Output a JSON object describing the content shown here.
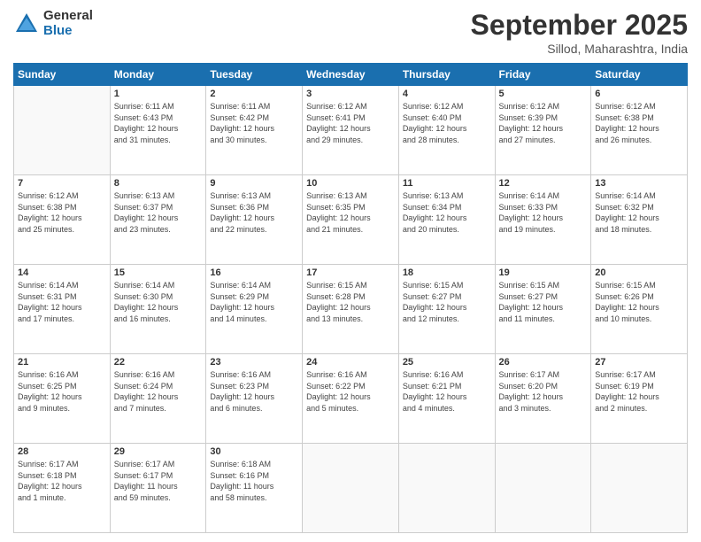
{
  "logo": {
    "general": "General",
    "blue": "Blue"
  },
  "header": {
    "month": "September 2025",
    "location": "Sillod, Maharashtra, India"
  },
  "weekdays": [
    "Sunday",
    "Monday",
    "Tuesday",
    "Wednesday",
    "Thursday",
    "Friday",
    "Saturday"
  ],
  "weeks": [
    [
      {
        "day": "",
        "info": ""
      },
      {
        "day": "1",
        "info": "Sunrise: 6:11 AM\nSunset: 6:43 PM\nDaylight: 12 hours\nand 31 minutes."
      },
      {
        "day": "2",
        "info": "Sunrise: 6:11 AM\nSunset: 6:42 PM\nDaylight: 12 hours\nand 30 minutes."
      },
      {
        "day": "3",
        "info": "Sunrise: 6:12 AM\nSunset: 6:41 PM\nDaylight: 12 hours\nand 29 minutes."
      },
      {
        "day": "4",
        "info": "Sunrise: 6:12 AM\nSunset: 6:40 PM\nDaylight: 12 hours\nand 28 minutes."
      },
      {
        "day": "5",
        "info": "Sunrise: 6:12 AM\nSunset: 6:39 PM\nDaylight: 12 hours\nand 27 minutes."
      },
      {
        "day": "6",
        "info": "Sunrise: 6:12 AM\nSunset: 6:38 PM\nDaylight: 12 hours\nand 26 minutes."
      }
    ],
    [
      {
        "day": "7",
        "info": "Sunrise: 6:12 AM\nSunset: 6:38 PM\nDaylight: 12 hours\nand 25 minutes."
      },
      {
        "day": "8",
        "info": "Sunrise: 6:13 AM\nSunset: 6:37 PM\nDaylight: 12 hours\nand 23 minutes."
      },
      {
        "day": "9",
        "info": "Sunrise: 6:13 AM\nSunset: 6:36 PM\nDaylight: 12 hours\nand 22 minutes."
      },
      {
        "day": "10",
        "info": "Sunrise: 6:13 AM\nSunset: 6:35 PM\nDaylight: 12 hours\nand 21 minutes."
      },
      {
        "day": "11",
        "info": "Sunrise: 6:13 AM\nSunset: 6:34 PM\nDaylight: 12 hours\nand 20 minutes."
      },
      {
        "day": "12",
        "info": "Sunrise: 6:14 AM\nSunset: 6:33 PM\nDaylight: 12 hours\nand 19 minutes."
      },
      {
        "day": "13",
        "info": "Sunrise: 6:14 AM\nSunset: 6:32 PM\nDaylight: 12 hours\nand 18 minutes."
      }
    ],
    [
      {
        "day": "14",
        "info": "Sunrise: 6:14 AM\nSunset: 6:31 PM\nDaylight: 12 hours\nand 17 minutes."
      },
      {
        "day": "15",
        "info": "Sunrise: 6:14 AM\nSunset: 6:30 PM\nDaylight: 12 hours\nand 16 minutes."
      },
      {
        "day": "16",
        "info": "Sunrise: 6:14 AM\nSunset: 6:29 PM\nDaylight: 12 hours\nand 14 minutes."
      },
      {
        "day": "17",
        "info": "Sunrise: 6:15 AM\nSunset: 6:28 PM\nDaylight: 12 hours\nand 13 minutes."
      },
      {
        "day": "18",
        "info": "Sunrise: 6:15 AM\nSunset: 6:27 PM\nDaylight: 12 hours\nand 12 minutes."
      },
      {
        "day": "19",
        "info": "Sunrise: 6:15 AM\nSunset: 6:27 PM\nDaylight: 12 hours\nand 11 minutes."
      },
      {
        "day": "20",
        "info": "Sunrise: 6:15 AM\nSunset: 6:26 PM\nDaylight: 12 hours\nand 10 minutes."
      }
    ],
    [
      {
        "day": "21",
        "info": "Sunrise: 6:16 AM\nSunset: 6:25 PM\nDaylight: 12 hours\nand 9 minutes."
      },
      {
        "day": "22",
        "info": "Sunrise: 6:16 AM\nSunset: 6:24 PM\nDaylight: 12 hours\nand 7 minutes."
      },
      {
        "day": "23",
        "info": "Sunrise: 6:16 AM\nSunset: 6:23 PM\nDaylight: 12 hours\nand 6 minutes."
      },
      {
        "day": "24",
        "info": "Sunrise: 6:16 AM\nSunset: 6:22 PM\nDaylight: 12 hours\nand 5 minutes."
      },
      {
        "day": "25",
        "info": "Sunrise: 6:16 AM\nSunset: 6:21 PM\nDaylight: 12 hours\nand 4 minutes."
      },
      {
        "day": "26",
        "info": "Sunrise: 6:17 AM\nSunset: 6:20 PM\nDaylight: 12 hours\nand 3 minutes."
      },
      {
        "day": "27",
        "info": "Sunrise: 6:17 AM\nSunset: 6:19 PM\nDaylight: 12 hours\nand 2 minutes."
      }
    ],
    [
      {
        "day": "28",
        "info": "Sunrise: 6:17 AM\nSunset: 6:18 PM\nDaylight: 12 hours\nand 1 minute."
      },
      {
        "day": "29",
        "info": "Sunrise: 6:17 AM\nSunset: 6:17 PM\nDaylight: 11 hours\nand 59 minutes."
      },
      {
        "day": "30",
        "info": "Sunrise: 6:18 AM\nSunset: 6:16 PM\nDaylight: 11 hours\nand 58 minutes."
      },
      {
        "day": "",
        "info": ""
      },
      {
        "day": "",
        "info": ""
      },
      {
        "day": "",
        "info": ""
      },
      {
        "day": "",
        "info": ""
      }
    ]
  ]
}
